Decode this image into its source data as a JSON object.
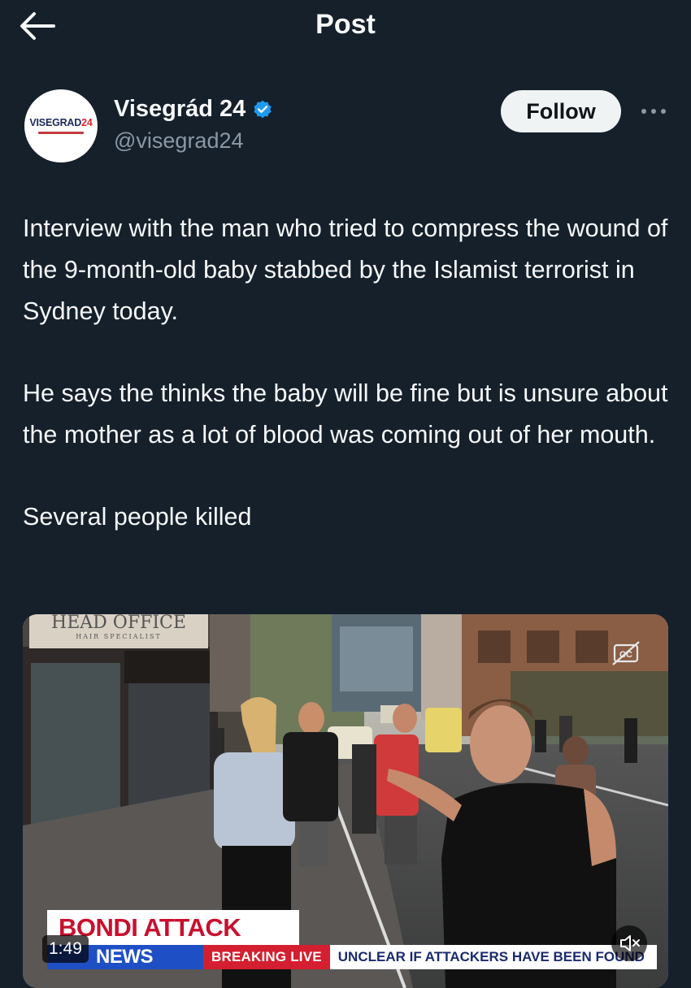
{
  "header": {
    "title": "Post",
    "back_icon": "arrow-left-icon"
  },
  "author": {
    "name": "Visegrád 24",
    "handle": "@visegrad24",
    "verified": true,
    "avatar_text_main": "VISEGRAD",
    "avatar_text_num": "24",
    "follow_label": "Follow",
    "more_icon": "ellipsis-icon"
  },
  "post": {
    "paragraphs": [
      "Interview with the man who tried to compress the wound of the 9-month-old baby stabbed by the Islamist terrorist in Sydney today.",
      "He says the thinks the baby will be fine but is unsure about the mother as a lot of blood was coming out of her mouth.",
      "Several people killed"
    ]
  },
  "video": {
    "sign_main": "HEAD OFFICE",
    "sign_sub": "HAIR SPECIALIST",
    "chyron_title": "BONDI ATTACK",
    "chyron_network": "NEWS",
    "chyron_live": "BREAKING LIVE",
    "chyron_ticker": "UNCLEAR IF ATTACKERS HAVE BEEN FOUND",
    "duration": "1:49",
    "cc_icon": "closed-captions-icon",
    "mute_icon": "speaker-muted-icon"
  },
  "colors": {
    "background": "#15202b",
    "text": "#f7f9f9",
    "secondary_text": "#8b98a5",
    "verified_blue": "#1d9bf0",
    "follow_bg": "#eff3f4",
    "chyron_red": "#c8102e",
    "chyron_blue": "#1f4fc4"
  }
}
